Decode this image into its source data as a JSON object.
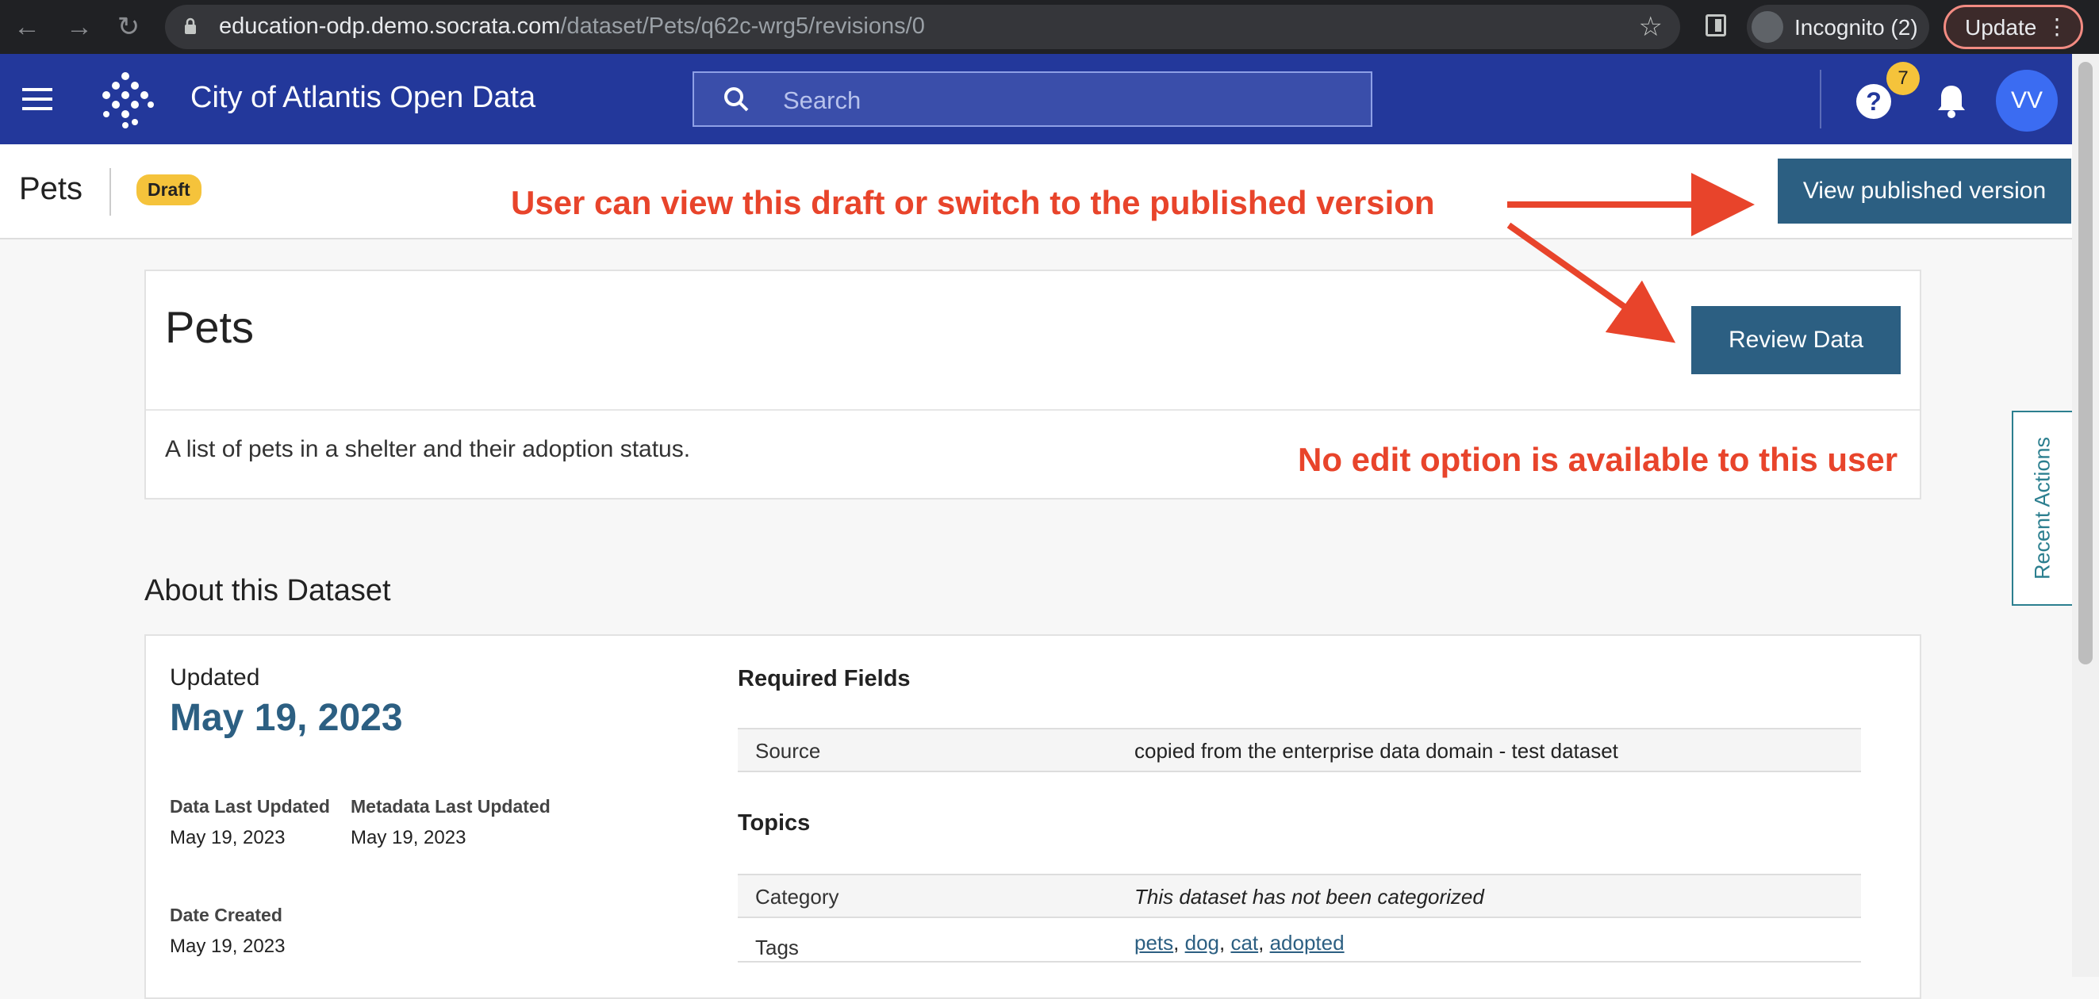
{
  "browser": {
    "url_host": "education-odp.demo.socrata.com",
    "url_path": "/dataset/Pets/q62c-wrg5/revisions/0",
    "incognito_label": "Incognito (2)",
    "update_label": "Update"
  },
  "header": {
    "site_title": "City of Atlantis Open Data",
    "search_placeholder": "Search",
    "help_badge_count": "7",
    "user_initials": "VV",
    "brand_color": "#23389b"
  },
  "titlebar": {
    "title": "Pets",
    "badge": "Draft",
    "view_published_label": "View published version"
  },
  "annotations": {
    "top": "User can view this draft or switch to the published version",
    "bottom": "No edit option is available to this user",
    "color": "#e8442b"
  },
  "dataset": {
    "name": "Pets",
    "review_label": "Review Data",
    "description": "A list of pets in a shelter and their adoption status."
  },
  "recent_actions": "Recent Actions",
  "about": {
    "heading": "About this Dataset",
    "updated_label": "Updated",
    "updated_date": "May 19, 2023",
    "data_last_updated_label": "Data Last Updated",
    "data_last_updated": "May 19, 2023",
    "metadata_last_updated_label": "Metadata Last Updated",
    "metadata_last_updated": "May 19, 2023",
    "date_created_label": "Date Created",
    "date_created": "May 19, 2023",
    "required_fields_heading": "Required Fields",
    "source_key": "Source",
    "source_value": "copied from the enterprise data domain - test dataset",
    "topics_heading": "Topics",
    "category_key": "Category",
    "category_value": "This dataset has not been categorized",
    "tags_key": "Tags",
    "tags": [
      "pets",
      "dog",
      "cat",
      "adopted"
    ]
  }
}
